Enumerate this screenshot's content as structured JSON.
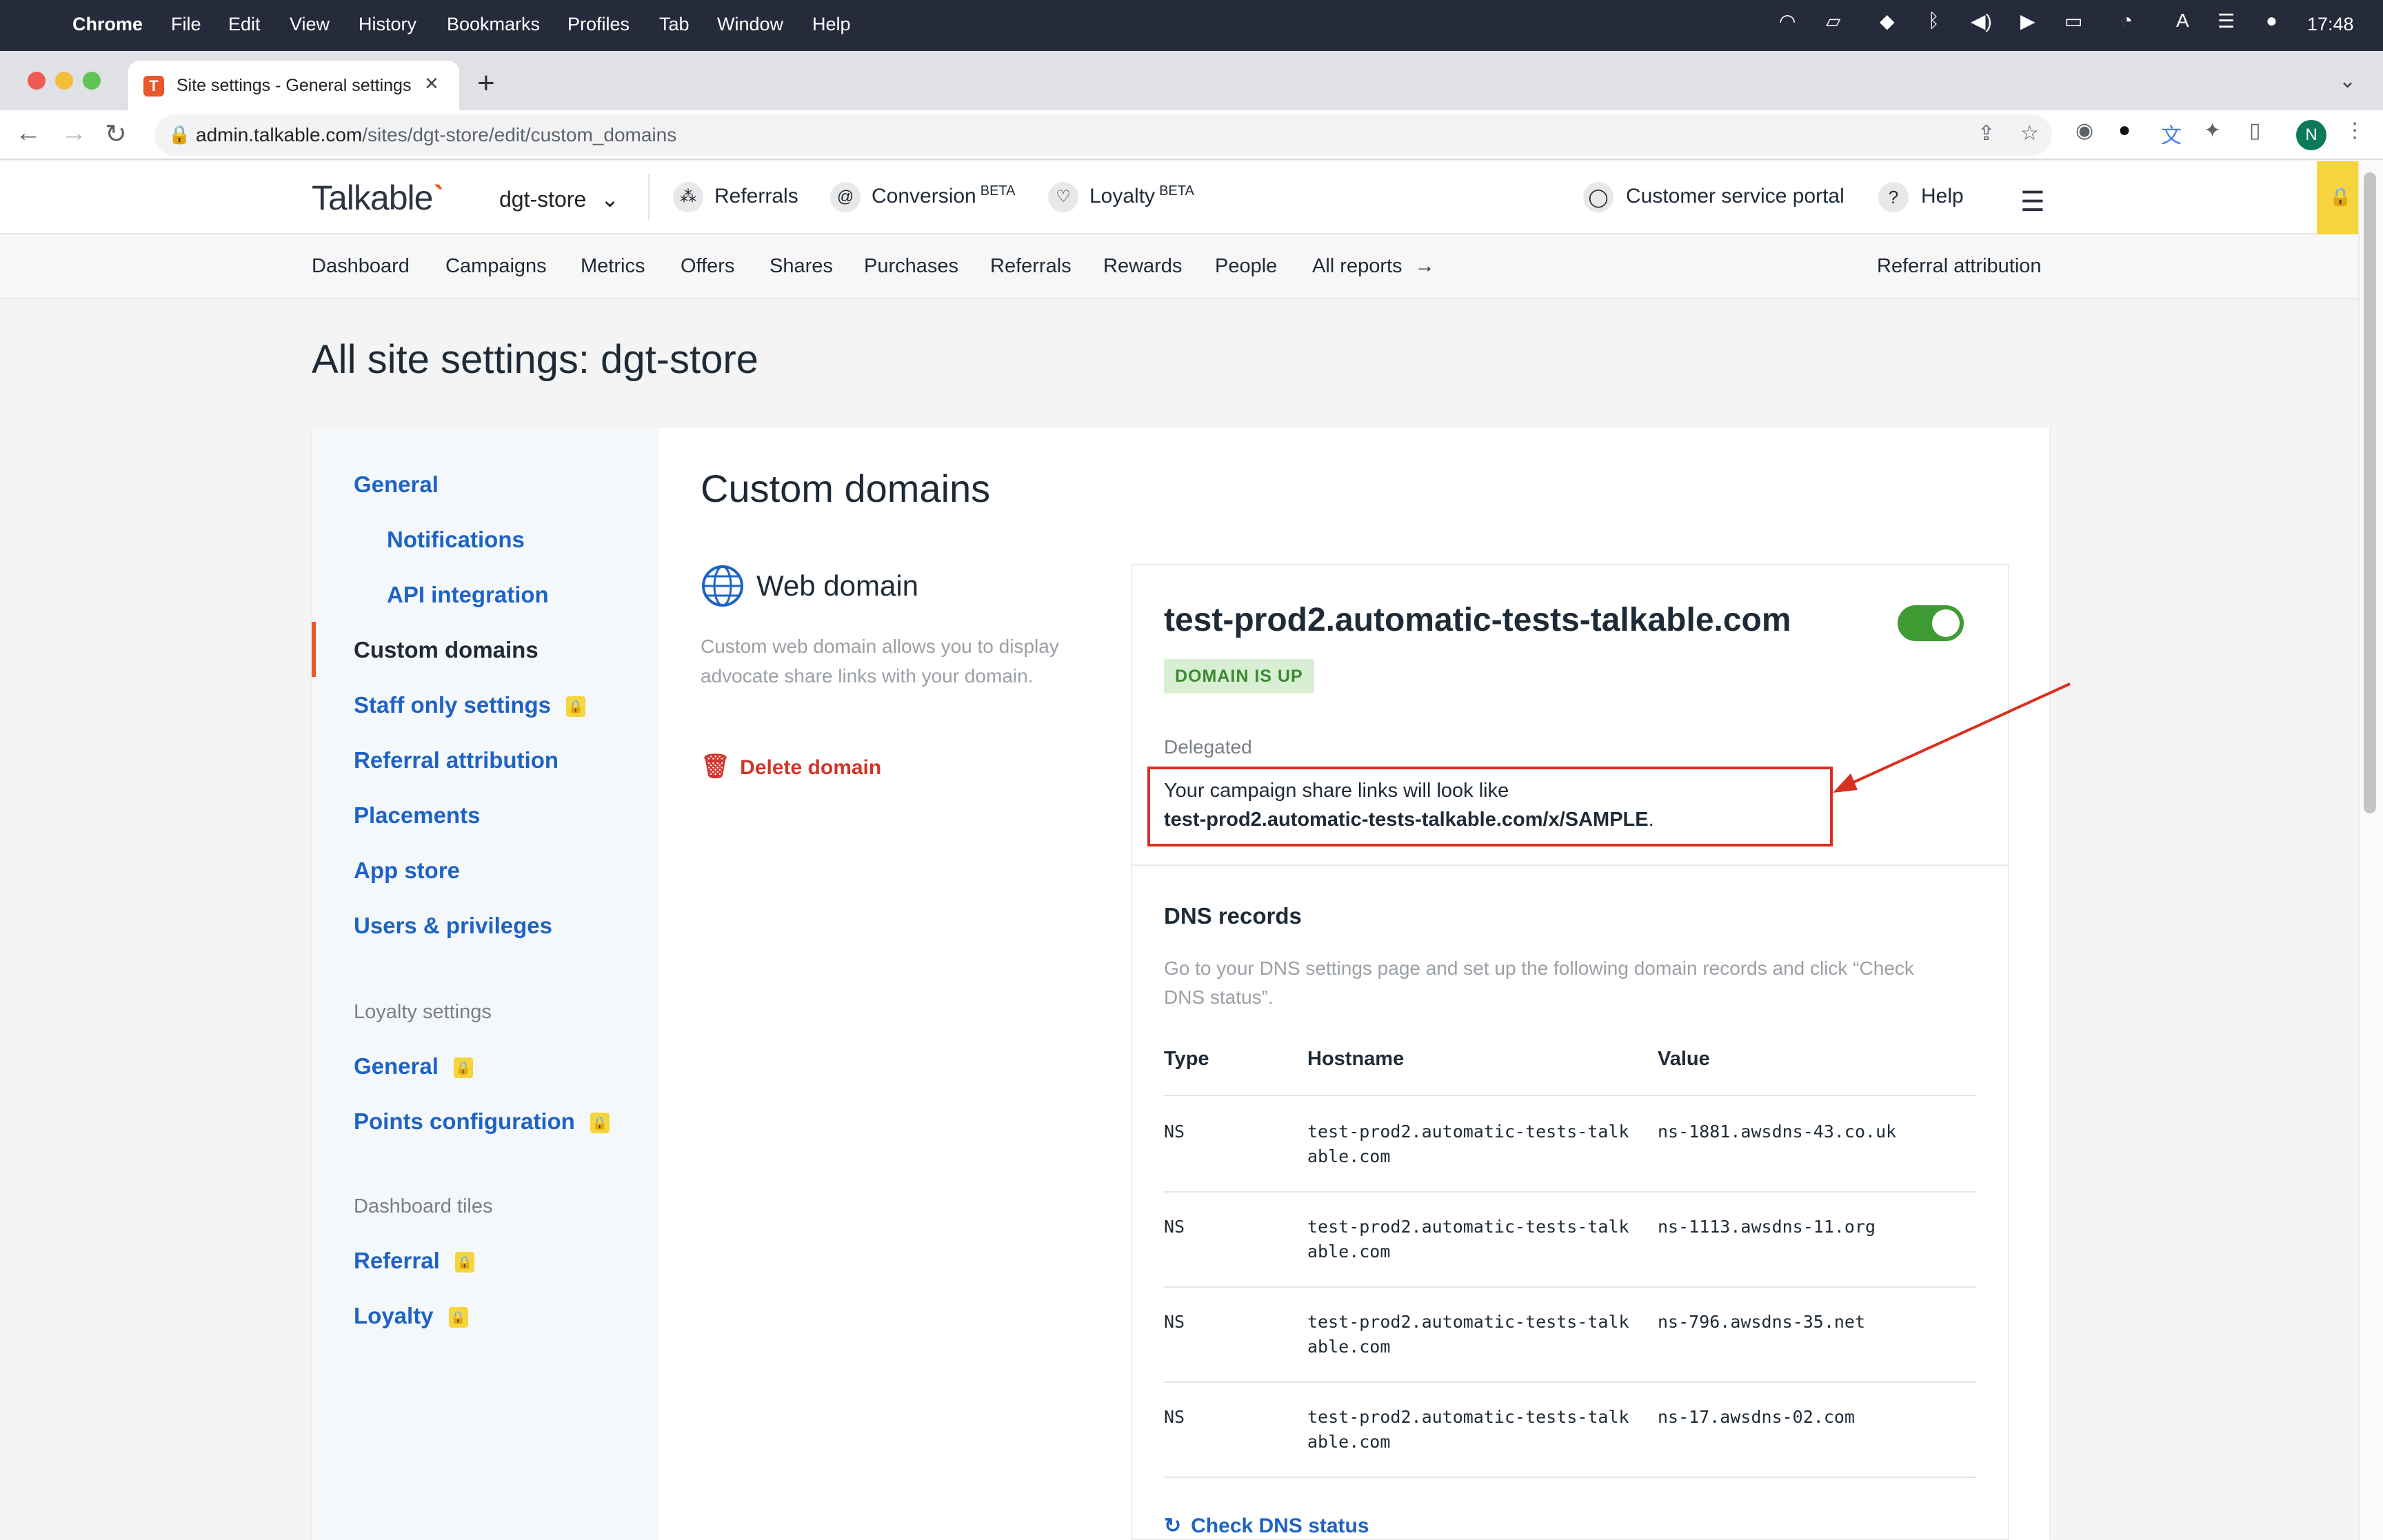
{
  "menubar": {
    "app": "Chrome",
    "items": [
      "File",
      "Edit",
      "View",
      "History",
      "Bookmarks",
      "Profiles",
      "Tab",
      "Window",
      "Help"
    ],
    "clock": "17:48"
  },
  "browser": {
    "tab_title": "Site settings - General settings",
    "tab_favicon": "T",
    "url_domain": "admin.talkable.com",
    "url_path": "/sites/dgt-store/edit/custom_domains",
    "profile_initial": "N"
  },
  "header": {
    "logo": "Talkable",
    "site": "dgt-store",
    "products": [
      {
        "label": "Referrals",
        "sup": ""
      },
      {
        "label": "Conversion",
        "sup": "BETA"
      },
      {
        "label": "Loyalty",
        "sup": "BETA"
      }
    ],
    "customer_portal": "Customer service portal",
    "help": "Help",
    "help_icon": "?"
  },
  "subnav": {
    "items": [
      "Dashboard",
      "Campaigns",
      "Metrics",
      "Offers",
      "Shares",
      "Purchases",
      "Referrals",
      "Rewards",
      "People",
      "All reports"
    ],
    "right": "Referral attribution"
  },
  "page": {
    "title": "All site settings: dgt-store"
  },
  "sidebar": {
    "items": [
      {
        "label": "General"
      },
      {
        "label": "Notifications"
      },
      {
        "label": "API integration"
      },
      {
        "label": "Custom domains"
      },
      {
        "label": "Staff only settings"
      },
      {
        "label": "Referral attribution"
      },
      {
        "label": "Placements"
      },
      {
        "label": "App store"
      },
      {
        "label": "Users & privileges"
      }
    ],
    "loyalty_group": "Loyalty settings",
    "loyalty_items": [
      {
        "label": "General"
      },
      {
        "label": "Points configuration"
      }
    ],
    "tiles_group": "Dashboard tiles",
    "tiles_items": [
      {
        "label": "Referral"
      },
      {
        "label": "Loyalty"
      }
    ]
  },
  "main": {
    "title": "Custom domains",
    "web_domain": {
      "title": "Web domain",
      "description": "Custom web domain allows you to display advocate share links with your domain.",
      "delete_label": "Delete domain"
    },
    "domain": {
      "name": "test-prod2.automatic-tests-talkable.com",
      "enabled": true,
      "status_badge": "DOMAIN IS UP",
      "delegated_label": "Delegated",
      "links_note": "Your campaign share links will look like",
      "sample_link": "test-prod2.automatic-tests-talkable.com/x/SAMPLE",
      "sample_suffix": "."
    },
    "dns": {
      "title": "DNS records",
      "description": "Go to your DNS settings page and set up the following domain records and click “Check DNS status”.",
      "columns": [
        "Type",
        "Hostname",
        "Value"
      ],
      "rows": [
        {
          "type": "NS",
          "host_1": "test-prod2.automatic-tests-talk",
          "host_2": "able.com",
          "value": "ns-1881.awsdns-43.co.uk"
        },
        {
          "type": "NS",
          "host_1": "test-prod2.automatic-tests-talk",
          "host_2": "able.com",
          "value": "ns-1113.awsdns-11.org"
        },
        {
          "type": "NS",
          "host_1": "test-prod2.automatic-tests-talk",
          "host_2": "able.com",
          "value": "ns-796.awsdns-35.net"
        },
        {
          "type": "NS",
          "host_1": "test-prod2.automatic-tests-talk",
          "host_2": "able.com",
          "value": "ns-17.awsdns-02.com"
        }
      ],
      "check_label": "Check DNS status"
    }
  },
  "colors": {
    "brand_accent": "#e9582b",
    "link_blue": "#1e63c4",
    "toggle_on": "#3f9c35",
    "badge_bg": "#d8efd4",
    "annotation_red": "#d8301f",
    "lock_yellow": "#f6d43d"
  }
}
